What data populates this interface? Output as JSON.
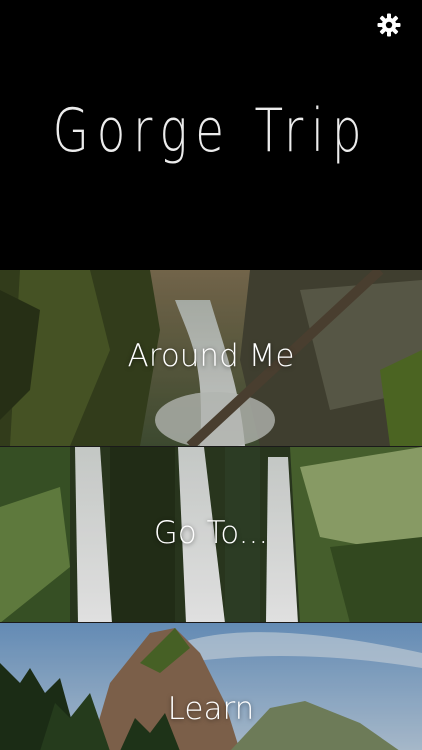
{
  "header": {
    "title": "Gorge Trip",
    "settings_icon": "gear-icon"
  },
  "menu": {
    "items": [
      {
        "label": "Around Me"
      },
      {
        "label": "Go To..."
      },
      {
        "label": "Learn"
      }
    ]
  },
  "colors": {
    "background": "#000000",
    "title_text": "#ececec",
    "tile_text": "#ffffff"
  }
}
